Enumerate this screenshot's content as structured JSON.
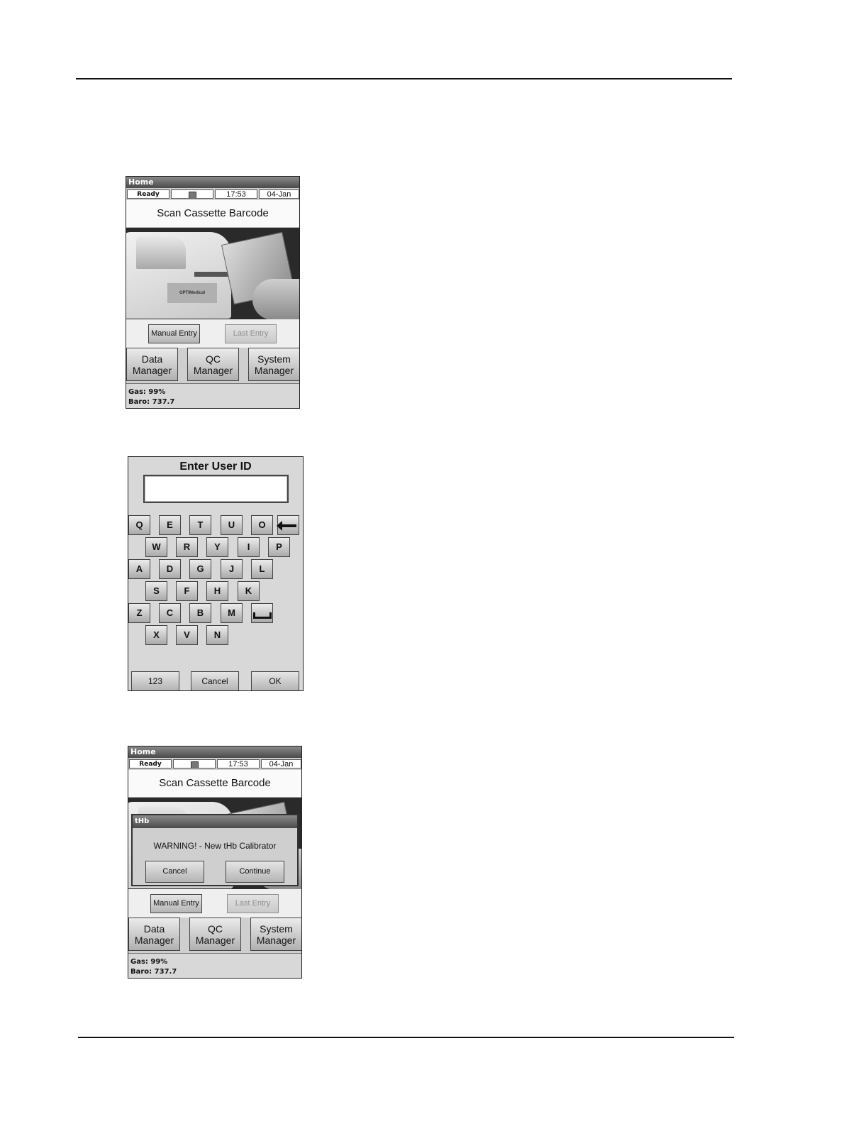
{
  "home": {
    "title": "Home",
    "status": {
      "state": "Ready",
      "icon": "usb-drive-icon",
      "time": "17:53",
      "date": "04-Jan"
    },
    "prompt": "Scan Cassette Barcode",
    "photo_brand": "OPTIMedical",
    "manual_entry": "Manual Entry",
    "last_entry": "Last Entry",
    "menu": [
      {
        "line1": "Data",
        "line2": "Manager"
      },
      {
        "line1": "QC",
        "line2": "Manager"
      },
      {
        "line1": "System",
        "line2": "Manager"
      }
    ],
    "gas": "Gas: 99%",
    "baro": "Baro: 737.7"
  },
  "keyboard": {
    "title": "Enter User ID",
    "value": "",
    "keys": {
      "row1": [
        "Q",
        "E",
        "T",
        "U",
        "O"
      ],
      "row2": [
        "W",
        "R",
        "Y",
        "I",
        "P"
      ],
      "row3": [
        "A",
        "D",
        "G",
        "J",
        "L"
      ],
      "row4": [
        "S",
        "F",
        "H",
        "K"
      ],
      "row5": [
        "Z",
        "C",
        "B",
        "M"
      ],
      "row6": [
        "X",
        "V",
        "N"
      ]
    },
    "numeric": "123",
    "cancel": "Cancel",
    "ok": "OK"
  },
  "dialog": {
    "title": "tHb",
    "message": "WARNING! - New tHb Calibrator",
    "cancel": "Cancel",
    "continue": "Continue"
  }
}
